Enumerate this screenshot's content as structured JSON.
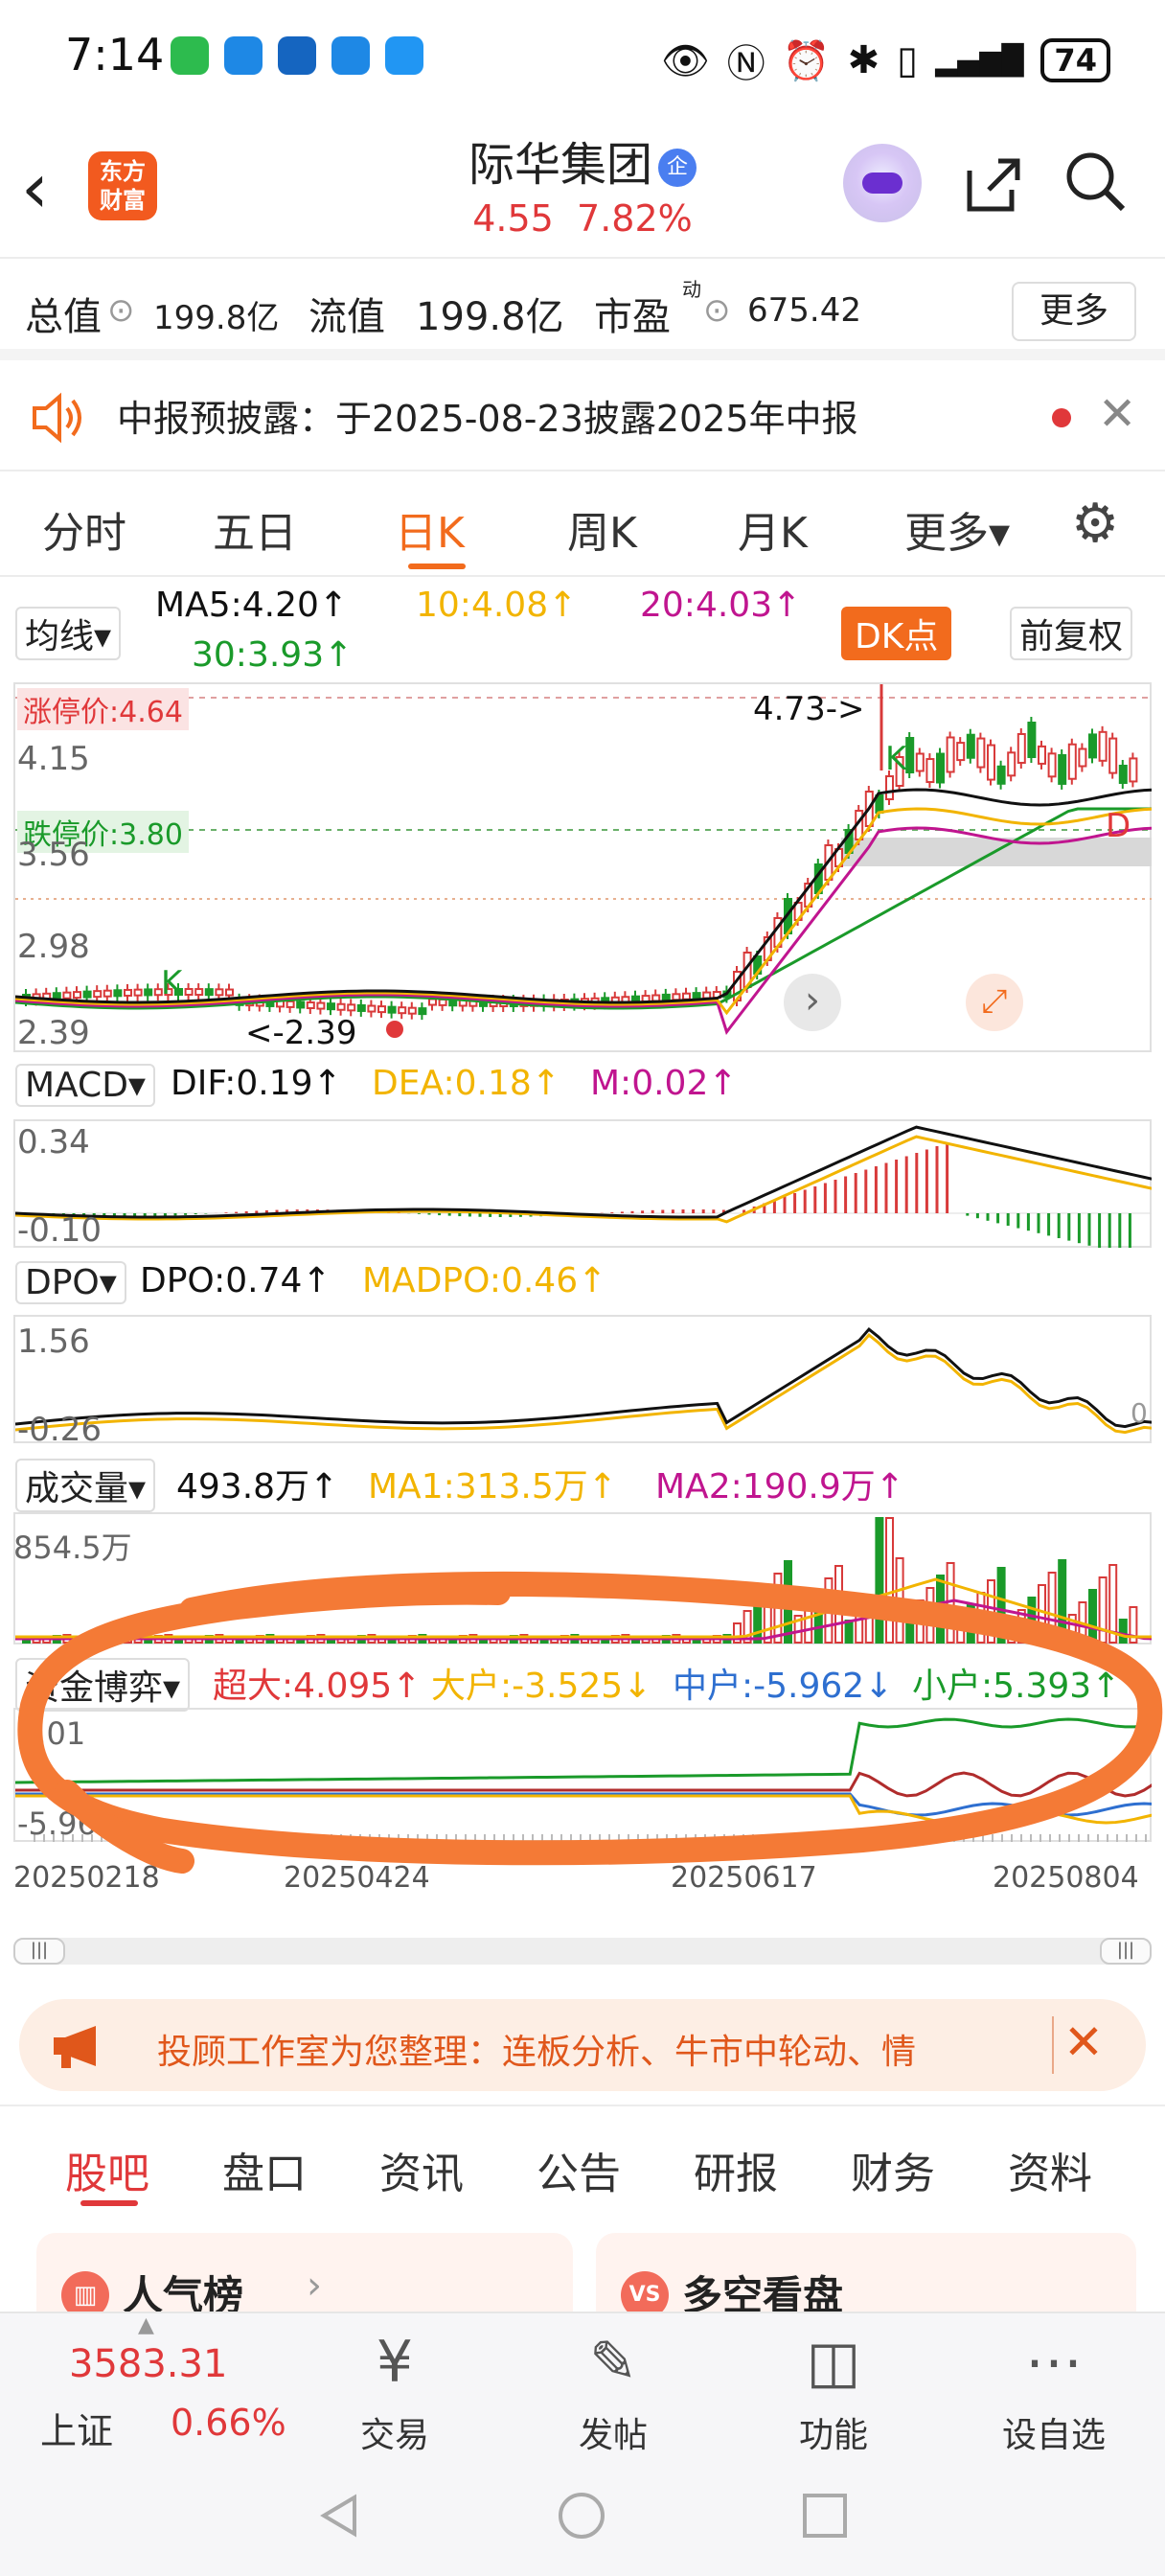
{
  "status": {
    "time": "7:14",
    "battery": "74"
  },
  "header": {
    "logo_text": "东方\n财富",
    "name": "际华集团",
    "name_badge": "企",
    "price": "4.55",
    "change_pct": "7.82%"
  },
  "stats": {
    "market_cap_label": "总值",
    "market_cap": "199.8亿",
    "float_cap_label": "流值",
    "float_cap": "199.8亿",
    "pe_label": "市盈",
    "pe_sup": "动",
    "pe": "675.42",
    "more": "更多"
  },
  "notice": {
    "text": "中报预披露：于2025-08-23披露2025年中报"
  },
  "tabs": [
    "分时",
    "五日",
    "日K",
    "周K",
    "月K",
    "更多▾"
  ],
  "active_tab": "日K",
  "ma": {
    "selector": "均线▾",
    "ma5": "MA5:4.20↑",
    "ma10": "10:4.08↑",
    "ma20": "20:4.03↑",
    "ma30": "30:3.93↑",
    "dk": "DK点",
    "adjust": "前复权"
  },
  "kchart": {
    "limit_up": "涨停价:4.64",
    "limit_down": "跌停价:3.80",
    "y_labels": [
      "4.15",
      "3.56",
      "2.98",
      "2.39"
    ],
    "high_annot": "4.73->",
    "low_annot": "<-2.39",
    "k_marker": "K",
    "d_marker": "D"
  },
  "macd": {
    "selector": "MACD▾",
    "dif": "DIF:0.19↑",
    "dea": "DEA:0.18↑",
    "m": "M:0.02↑",
    "y_top": "0.34",
    "y_bottom": "-0.10"
  },
  "dpo": {
    "selector": "DPO▾",
    "dpo": "DPO:0.74↑",
    "madpo": "MADPO:0.46↑",
    "y_top": "1.56",
    "y_bottom": "-0.26",
    "y_zero": "0"
  },
  "volume": {
    "selector": "成交量▾",
    "vol": "493.8万↑",
    "ma1": "MA1:313.5万↑",
    "ma2": "MA2:190.9万↑",
    "y_top": "854.5万"
  },
  "capital": {
    "selector": "资金博弈▾",
    "super": "超大:4.095↑",
    "big": "大户:-3.525↓",
    "mid": "中户:-5.962↓",
    "small": "小户:5.393↑",
    "y_top": "9.01",
    "y_bottom": "-5.96",
    "dates": [
      "20250218",
      "20250424",
      "20250617",
      "20250804"
    ]
  },
  "banner": {
    "text": "投顾工作室为您整理：连板分析、牛市中轮动、情"
  },
  "bottom_tabs": [
    "股吧",
    "盘口",
    "资讯",
    "公告",
    "研报",
    "财务",
    "资料"
  ],
  "cards": {
    "left": "人气榜",
    "right": "多空看盘"
  },
  "bottombar": {
    "index_value": "3583.31",
    "index_name": "上证",
    "index_change": "0.66%",
    "trade": "交易",
    "post": "发帖",
    "func": "功能",
    "watch": "设自选"
  }
}
